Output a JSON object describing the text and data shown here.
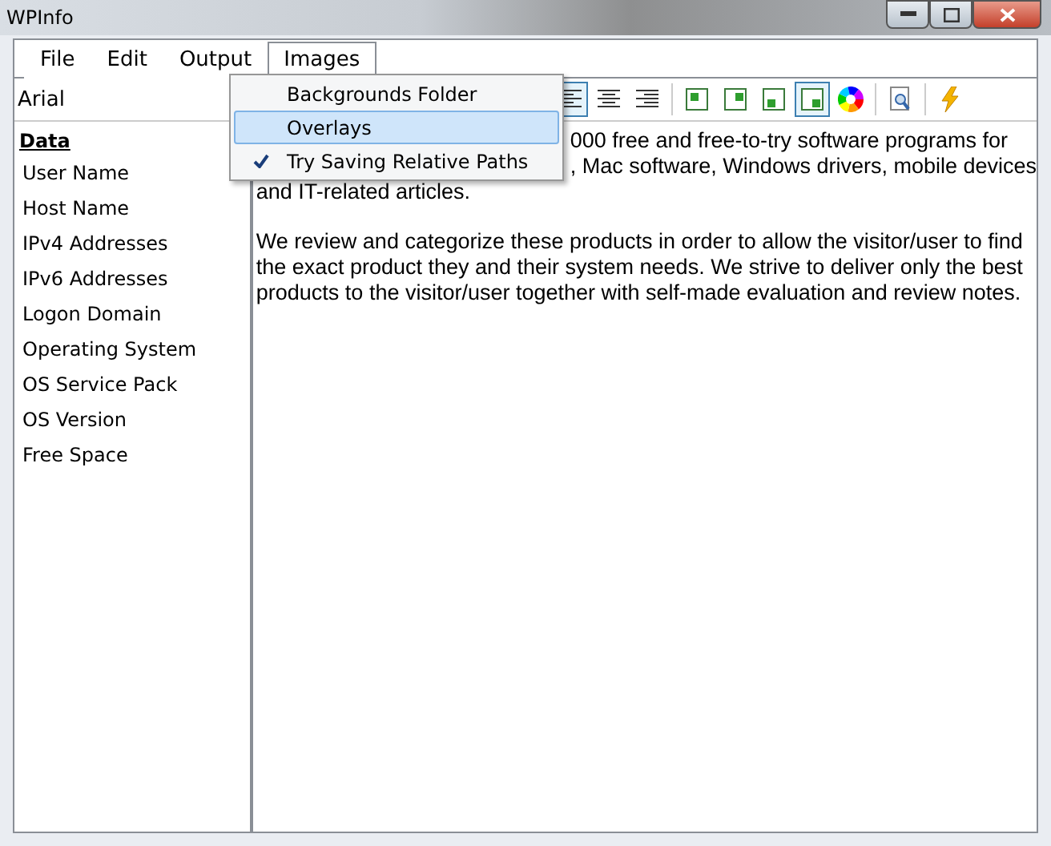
{
  "window": {
    "title": "WPInfo"
  },
  "menu": [
    {
      "label": "File",
      "selected": false
    },
    {
      "label": "Edit",
      "selected": false
    },
    {
      "label": "Output",
      "selected": false
    },
    {
      "label": "Images",
      "selected": true
    }
  ],
  "dropdown": [
    {
      "label": "Backgrounds Folder",
      "selected": false,
      "checked": false
    },
    {
      "label": "Overlays",
      "selected": true,
      "checked": false
    },
    {
      "label": "Try Saving Relative Paths",
      "selected": false,
      "checked": true
    }
  ],
  "font_field": {
    "value": "Arial"
  },
  "toolbar": [
    {
      "kind": "align-left",
      "selected": true
    },
    {
      "kind": "align-center",
      "selected": false
    },
    {
      "kind": "align-right",
      "selected": false
    },
    {
      "kind": "sep"
    },
    {
      "kind": "pos-tl",
      "selected": false
    },
    {
      "kind": "pos-tr",
      "selected": false
    },
    {
      "kind": "pos-bl",
      "selected": false
    },
    {
      "kind": "pos-br",
      "selected": true
    },
    {
      "kind": "color",
      "selected": false
    },
    {
      "kind": "sep"
    },
    {
      "kind": "preview",
      "selected": false
    },
    {
      "kind": "sep"
    },
    {
      "kind": "run",
      "selected": false
    }
  ],
  "sidebar": {
    "heading": "Data",
    "items": [
      "User Name",
      "Host Name",
      "IPv4 Addresses",
      "IPv6 Addresses",
      "Logon Domain",
      "Operating System",
      "OS Service Pack",
      "OS Version",
      "Free Space"
    ]
  },
  "editor": {
    "covered_lines": [
      "000 free and free-to-try software programs for",
      ", Mac software, Windows drivers, mobile devices"
    ],
    "lines": [
      "and IT-related articles."
    ],
    "paragraph": "We review and categorize these products in order to allow the visitor/user to find the exact product they and their system needs. We strive to deliver only the best products to the visitor/user together with self-made evaluation and review notes."
  }
}
